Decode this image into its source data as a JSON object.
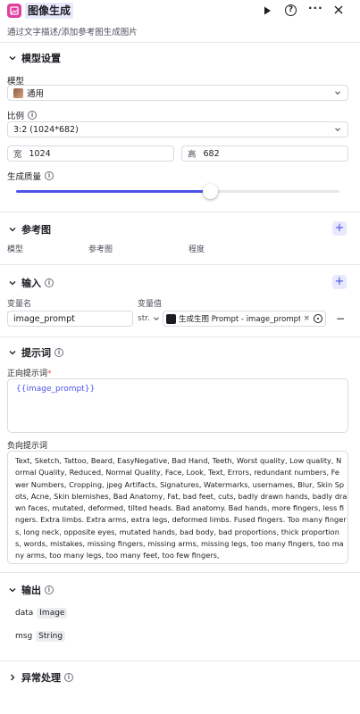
{
  "header": {
    "title": "图像生成",
    "description": "通过文字描述/添加参考图生成图片"
  },
  "model_settings": {
    "section_title": "模型设置",
    "model_label": "模型",
    "model_value": "通用",
    "ratio_label": "比例",
    "ratio_value": "3:2 (1024*682)",
    "width_label": "宽",
    "width_value": "1024",
    "height_label": "高",
    "height_value": "682",
    "quality_label": "生成质量",
    "quality_level": 0.6
  },
  "reference": {
    "section_title": "参考图",
    "col_model": "模型",
    "col_image": "参考图",
    "col_degree": "程度"
  },
  "input": {
    "section_title": "输入",
    "col_name": "变量名",
    "col_value": "变量值",
    "var_name": "image_prompt",
    "var_type": "str.",
    "ref_node": "生成生图 Prompt",
    "ref_sep": " - ",
    "ref_var": "image_prompt"
  },
  "prompt": {
    "section_title": "提示词",
    "positive_label": "正向提示词",
    "required_mark": "*",
    "positive_value": "{{image_prompt}}",
    "negative_label": "负向提示词",
    "negative_lines": [
      "Text, Sketch, Tattoo, Beard, EasyNegative, Bad Hand, Teeth, Worst quality, Low quality, N",
      "ormal Quality, Reduced, Normal Quality, Face, Look, Text, Errors, redundant numbers, Fe",
      "wer Numbers, Cropping, jpeg Artifacts, Signatures, Watermarks, usernames, Blur, Skin Sp",
      "ots, Acne, Skin blemishes, Bad Anatomy, Fat, bad feet, cuts, badly drawn hands, badly dra",
      "wn faces, mutated, deformed, tilted heads. Bad anatomy. Bad hands, more fingers, less fi",
      "ngers. Extra limbs. Extra arms, extra legs, deformed limbs. Fused fingers. Too many finger",
      "s, long neck, opposite eyes, mutated hands, bad body, bad proportions, thick proportion",
      "s, words, mistakes, missing fingers, missing arms, missing legs, too many fingers, too ma",
      "ny arms, too many legs, too many feet, too few fingers,"
    ]
  },
  "output": {
    "section_title": "输出",
    "items": [
      {
        "name": "data",
        "type": "Image"
      },
      {
        "name": "msg",
        "type": "String"
      }
    ]
  },
  "exception": {
    "section_title": "异常处理"
  },
  "colors": {
    "accent": "#4d53e8",
    "icon_bg": "#e040a0"
  }
}
